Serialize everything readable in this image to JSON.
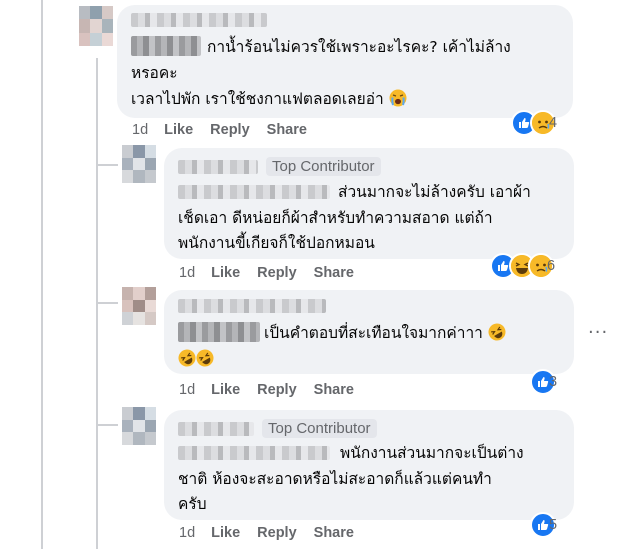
{
  "comments": [
    {
      "text_lines": [
        "กาน้ำร้อนไม่ควรใช้เพราะอะไรคะ? เค้าไม่ล้าง",
        "หรอคะ",
        "เวลาไปพัก เราใช้ชงกาแฟตลอดเลยอ่า"
      ],
      "emoji_suffix": "crying-face",
      "time": "1d",
      "like_label": "Like",
      "reply_label": "Reply",
      "share_label": "Share",
      "reaction_types": [
        "like",
        "sad"
      ],
      "reaction_count": "4"
    },
    {
      "badge": "Top Contributor",
      "text_lines": [
        "ส่วนมากจะไม่ล้างครับ เอาผ้า",
        "เช็ดเอา ดีหน่อยก็ผ้าสำหรับทำความสอาด แต่ถ้า",
        "พนักงานขี้เกียจก็ใช้ปอกหมอน"
      ],
      "time": "1d",
      "like_label": "Like",
      "reply_label": "Reply",
      "share_label": "Share",
      "reaction_types": [
        "like",
        "haha",
        "sad"
      ],
      "reaction_count": "6"
    },
    {
      "text_lines": [
        "เป็นคำตอบที่สะเทือนใจมากค่าาา"
      ],
      "emoji_suffix": "rofl",
      "emoji_line2": [
        "rofl",
        "rofl"
      ],
      "time": "1d",
      "like_label": "Like",
      "reply_label": "Reply",
      "share_label": "Share",
      "reaction_types": [
        "like"
      ],
      "reaction_count": "3",
      "more_icon": "ellipsis-icon",
      "more_label": "···"
    },
    {
      "badge": "Top Contributor",
      "text_lines": [
        "พนักงานส่วนมากจะเป็นต่าง",
        "ชาติ ห้องจะสะอาดหรือไม่สะอาดก็แล้วแต่คนทำ",
        "ครับ"
      ],
      "time": "1d",
      "like_label": "Like",
      "reply_label": "Reply",
      "share_label": "Share",
      "reaction_types": [
        "like"
      ],
      "reaction_count": "5"
    }
  ],
  "colors": {
    "bubble": "#f0f2f5",
    "like_blue": "#1877f2",
    "secondary_text": "#65676b",
    "emoji_yellow": "#f7b928"
  }
}
